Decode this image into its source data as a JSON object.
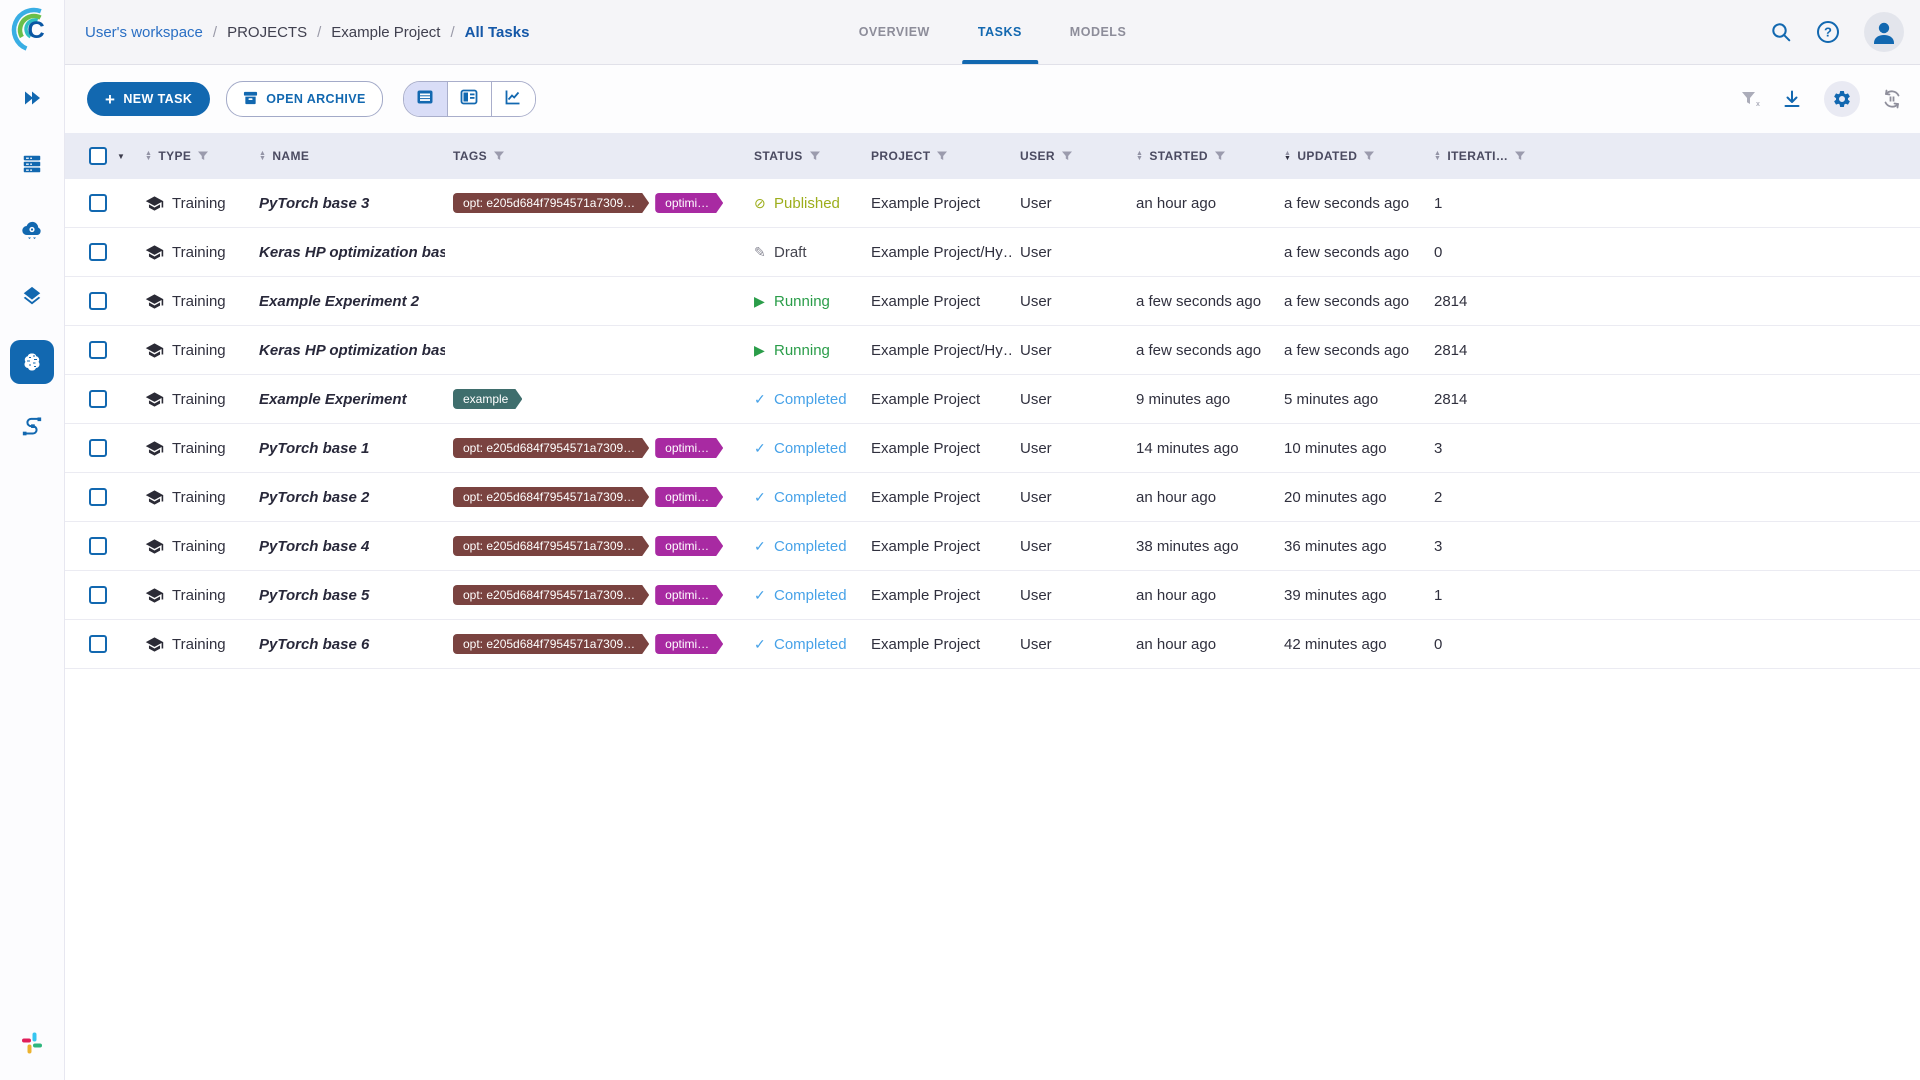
{
  "app": {
    "name": "ClearML"
  },
  "colors": {
    "accent_blue": "#1268b0",
    "breadcrumb_link": "#2a6fc4",
    "tab_inactive": "#8d8d9a",
    "topbar_bg": "#f5f5f8",
    "header_row_bg": "#e9ebf4",
    "status_published": "#9dae1c",
    "status_running": "#2a9d49",
    "status_completed": "#47a2e8",
    "status_draft": "#45454f",
    "tag_maroon": "#7a4340",
    "tag_magenta": "#a82aa2",
    "tag_teal": "#3f6e6d",
    "slack": [
      "#36C5F0",
      "#2EB67D",
      "#ECB22E",
      "#E01E5A"
    ]
  },
  "sidebar": {
    "items": [
      {
        "name": "expand-menu",
        "icon": "double-chevron-right-icon",
        "active": false
      },
      {
        "name": "workers-queues",
        "icon": "server-rack-icon",
        "active": false
      },
      {
        "name": "cloud-autoscalers",
        "icon": "cloud-gear-icon",
        "active": false
      },
      {
        "name": "datasets",
        "icon": "layers-icon",
        "active": false
      },
      {
        "name": "projects",
        "icon": "brain-icon",
        "active": true
      },
      {
        "name": "pipelines",
        "icon": "pipeline-icon",
        "active": false
      }
    ],
    "bottom_icon": "slack-icon"
  },
  "header": {
    "breadcrumb": [
      {
        "label": "User's workspace",
        "kind": "link"
      },
      {
        "label": "PROJECTS",
        "kind": "plain"
      },
      {
        "label": "Example Project",
        "kind": "plain"
      },
      {
        "label": "All Tasks",
        "kind": "current"
      }
    ],
    "tabs": [
      {
        "label": "OVERVIEW",
        "active": false
      },
      {
        "label": "TASKS",
        "active": true
      },
      {
        "label": "MODELS",
        "active": false
      }
    ],
    "icons": [
      "search-icon",
      "help-icon",
      "user-avatar"
    ]
  },
  "toolbar": {
    "new_task_label": "NEW TASK",
    "open_archive_label": "OPEN ARCHIVE",
    "view_modes": [
      {
        "name": "table-view",
        "selected": true
      },
      {
        "name": "detail-view",
        "selected": false
      },
      {
        "name": "compare-view",
        "selected": false
      }
    ],
    "right_icons": [
      "clear-filters-icon",
      "download-icon",
      "settings-gear-icon",
      "auto-refresh-icon"
    ]
  },
  "table": {
    "columns": [
      {
        "key": "type",
        "label": "TYPE",
        "sortable": true,
        "filterable": true,
        "sorted": "none"
      },
      {
        "key": "name",
        "label": "NAME",
        "sortable": true,
        "filterable": false,
        "sorted": "none"
      },
      {
        "key": "tags",
        "label": "TAGS",
        "sortable": false,
        "filterable": true,
        "sorted": "none"
      },
      {
        "key": "status",
        "label": "STATUS",
        "sortable": false,
        "filterable": true,
        "sorted": "none"
      },
      {
        "key": "project",
        "label": "PROJECT",
        "sortable": false,
        "filterable": true,
        "sorted": "none"
      },
      {
        "key": "user",
        "label": "USER",
        "sortable": false,
        "filterable": true,
        "sorted": "none"
      },
      {
        "key": "started",
        "label": "STARTED",
        "sortable": true,
        "filterable": true,
        "sorted": "none"
      },
      {
        "key": "updated",
        "label": "UPDATED",
        "sortable": true,
        "filterable": true,
        "sorted": "desc"
      },
      {
        "key": "iteration",
        "label": "ITERATI…",
        "sortable": true,
        "filterable": true,
        "sorted": "none"
      }
    ],
    "status_icons": {
      "published": "⊘",
      "draft": "✎",
      "running": "▶",
      "completed": "✓"
    },
    "rows": [
      {
        "type": "Training",
        "name": "PyTorch base 3",
        "tags": [
          {
            "label": "opt: e205d684f7954571a7309…",
            "color": "maroon"
          },
          {
            "label": "optimi…",
            "color": "magenta"
          }
        ],
        "status": "Published",
        "status_kind": "published",
        "project": "Example Project",
        "user": "User",
        "started": "an hour ago",
        "updated": "a few seconds ago",
        "iteration": "1"
      },
      {
        "type": "Training",
        "name": "Keras HP optimization base",
        "tags": [],
        "status": "Draft",
        "status_kind": "draft",
        "project": "Example Project/Hy…",
        "user": "User",
        "started": "",
        "updated": "a few seconds ago",
        "iteration": "0"
      },
      {
        "type": "Training",
        "name": "Example Experiment 2",
        "tags": [],
        "status": "Running",
        "status_kind": "running",
        "project": "Example Project",
        "user": "User",
        "started": "a few seconds ago",
        "updated": "a few seconds ago",
        "iteration": "2814"
      },
      {
        "type": "Training",
        "name": "Keras HP optimization base",
        "tags": [],
        "status": "Running",
        "status_kind": "running",
        "project": "Example Project/Hy…",
        "user": "User",
        "started": "a few seconds ago",
        "updated": "a few seconds ago",
        "iteration": "2814"
      },
      {
        "type": "Training",
        "name": "Example Experiment",
        "tags": [
          {
            "label": "example",
            "color": "teal"
          }
        ],
        "status": "Completed",
        "status_kind": "completed",
        "project": "Example Project",
        "user": "User",
        "started": "9 minutes ago",
        "updated": "5 minutes ago",
        "iteration": "2814"
      },
      {
        "type": "Training",
        "name": "PyTorch base 1",
        "tags": [
          {
            "label": "opt: e205d684f7954571a7309…",
            "color": "maroon"
          },
          {
            "label": "optimi…",
            "color": "magenta"
          }
        ],
        "status": "Completed",
        "status_kind": "completed",
        "project": "Example Project",
        "user": "User",
        "started": "14 minutes ago",
        "updated": "10 minutes ago",
        "iteration": "3"
      },
      {
        "type": "Training",
        "name": "PyTorch base 2",
        "tags": [
          {
            "label": "opt: e205d684f7954571a7309…",
            "color": "maroon"
          },
          {
            "label": "optimi…",
            "color": "magenta"
          }
        ],
        "status": "Completed",
        "status_kind": "completed",
        "project": "Example Project",
        "user": "User",
        "started": "an hour ago",
        "updated": "20 minutes ago",
        "iteration": "2"
      },
      {
        "type": "Training",
        "name": "PyTorch base 4",
        "tags": [
          {
            "label": "opt: e205d684f7954571a7309…",
            "color": "maroon"
          },
          {
            "label": "optimi…",
            "color": "magenta"
          }
        ],
        "status": "Completed",
        "status_kind": "completed",
        "project": "Example Project",
        "user": "User",
        "started": "38 minutes ago",
        "updated": "36 minutes ago",
        "iteration": "3"
      },
      {
        "type": "Training",
        "name": "PyTorch base 5",
        "tags": [
          {
            "label": "opt: e205d684f7954571a7309…",
            "color": "maroon"
          },
          {
            "label": "optimi…",
            "color": "magenta"
          }
        ],
        "status": "Completed",
        "status_kind": "completed",
        "project": "Example Project",
        "user": "User",
        "started": "an hour ago",
        "updated": "39 minutes ago",
        "iteration": "1"
      },
      {
        "type": "Training",
        "name": "PyTorch base 6",
        "tags": [
          {
            "label": "opt: e205d684f7954571a7309…",
            "color": "maroon"
          },
          {
            "label": "optimi…",
            "color": "magenta"
          }
        ],
        "status": "Completed",
        "status_kind": "completed",
        "project": "Example Project",
        "user": "User",
        "started": "an hour ago",
        "updated": "42 minutes ago",
        "iteration": "0"
      }
    ]
  }
}
